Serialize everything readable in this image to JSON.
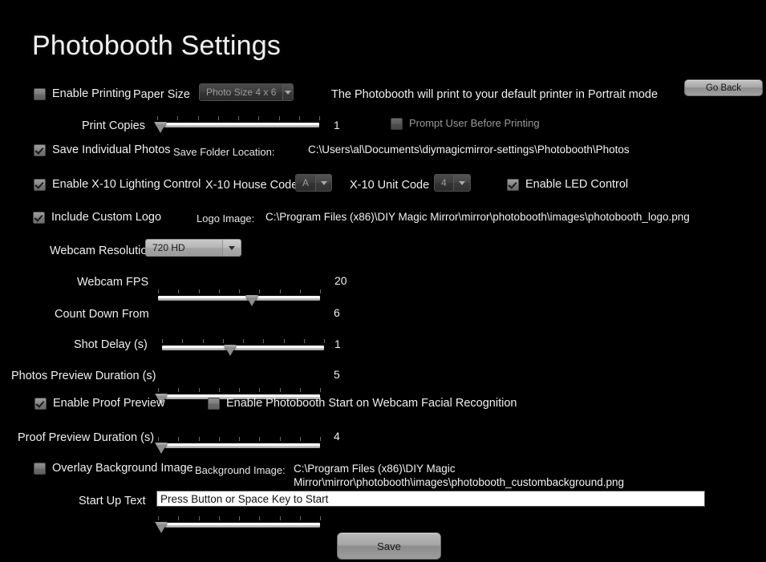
{
  "window": {
    "title": "Photobooth Settings",
    "background_color": "#000000",
    "text_color": "#f0f0f0"
  },
  "top_bar": {
    "go_back_label": "Go Back"
  },
  "printing": {
    "enable_printing_label": "Enable Printing",
    "enable_printing_checked": false,
    "paper_size_label": "Paper Size",
    "paper_size_value": "Photo Size 4 x 6",
    "paper_size_enabled": false,
    "printer_note": "The Photobooth will print to your default printer in Portrait mode",
    "print_copies_label": "Print Copies",
    "print_copies_value": "1",
    "print_copies_pct": 2,
    "prompt_user_label": "Prompt User Before Printing",
    "prompt_user_checked": false
  },
  "saving": {
    "save_individual_label": "Save Individual Photos",
    "save_individual_checked": true,
    "save_folder_label": "Save Folder Location:",
    "save_folder_path": "C:\\Users\\al\\Documents\\diymagicmirror-settings\\Photobooth\\Photos"
  },
  "lighting": {
    "enable_x10_label": "Enable X-10 Lighting Control",
    "enable_x10_checked": true,
    "house_code_label": "X-10 House Code",
    "house_code_value": "A",
    "unit_code_label": "X-10 Unit Code",
    "unit_code_value": "4",
    "enable_led_label": "Enable LED Control",
    "enable_led_checked": true
  },
  "logo": {
    "include_logo_label": "Include Custom Logo",
    "include_logo_checked": true,
    "logo_image_label": "Logo Image:",
    "logo_image_path": "C:\\Program Files (x86)\\DIY Magic Mirror\\mirror\\photobooth\\images\\photobooth_logo.png"
  },
  "webcam": {
    "resolution_label": "Webcam Resolution",
    "resolution_value": "720 HD",
    "fps_label": "Webcam FPS",
    "fps_value": "20",
    "fps_pct": 58
  },
  "capture": {
    "countdown_label": "Count Down From",
    "countdown_value": "6",
    "countdown_pct": 42,
    "shot_delay_label": "Shot Delay (s)",
    "shot_delay_value": "1",
    "shot_delay_pct": 2,
    "photos_preview_label": "Photos Preview Duration (s)",
    "photos_preview_value": "5",
    "photos_preview_pct": 2
  },
  "proof": {
    "enable_proof_label": "Enable Proof Preview",
    "enable_proof_checked": true,
    "facial_recognition_label": "Enable Photobooth Start on Webcam Facial Recognition",
    "facial_recognition_checked": false,
    "proof_duration_label": "Proof Preview Duration (s)",
    "proof_duration_value": "4",
    "proof_duration_pct": 2
  },
  "overlay": {
    "overlay_bg_label": "Overlay Background Image",
    "overlay_bg_checked": false,
    "background_image_label": "Background Image:",
    "background_image_path": "C:\\Program Files (x86)\\DIY Magic Mirror\\mirror\\photobooth\\images\\photobooth_custombackground.png"
  },
  "startup": {
    "start_up_text_label": "Start Up Text",
    "start_up_text_value": "Press Button or Space Key to Start"
  },
  "footer": {
    "save_label": "Save"
  }
}
